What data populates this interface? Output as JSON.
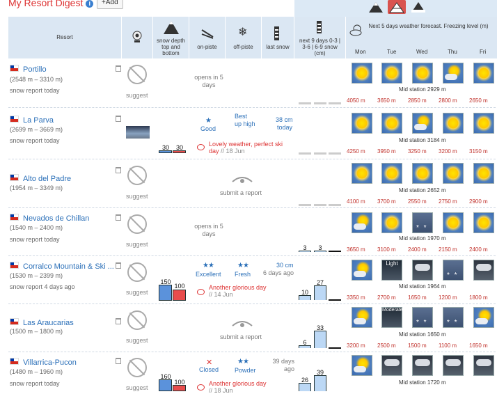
{
  "header": {
    "title": "My Resort Digest",
    "info_icon": "i",
    "add_label": "+Add"
  },
  "columns": {
    "resort": "Resort",
    "snow_depth": "snow depth top and bottom",
    "on_piste": "on-piste",
    "off_piste": "off-piste",
    "last_snow": "last snow",
    "next9": "next 9 days 0-3 | 3-6 | 6-9 snow (cm)",
    "forecast_title": "Next 5 days weather forecast. Freezing level (m)",
    "days": [
      "Mon",
      "Tue",
      "Wed",
      "Thu",
      "Fri"
    ]
  },
  "labels": {
    "suggest": "suggest",
    "submit_report": "submit a report",
    "mid_station": "Mid station"
  },
  "resorts": [
    {
      "name": "Portillo",
      "elev": "(2548 m – 3310 m)",
      "report": "snow report today",
      "opens": "opens in 5 days",
      "next9": [],
      "weather": [
        "sun",
        "sun",
        "sun",
        "pc",
        "sun"
      ],
      "mid": "2929 m",
      "freeze": [
        "4050 m",
        "3650 m",
        "2850 m",
        "2800 m",
        "2650 m"
      ]
    },
    {
      "name": "La Parva",
      "elev": "(2699 m – 3669 m)",
      "report": "snow report today",
      "depth": [
        "30",
        "30"
      ],
      "on_piste": "Good",
      "off_piste": "Best up high",
      "last_snow": "38 cm",
      "last_snow_when": "today",
      "comment": "Lovely weather, perfect ski day",
      "comment_date": "// 18 Jun",
      "weather": [
        "sun",
        "sun",
        "pc",
        "sun",
        "sun"
      ],
      "mid": "3184 m",
      "freeze": [
        "4250 m",
        "3950 m",
        "3250 m",
        "3200 m",
        "3150 m"
      ]
    },
    {
      "name": "Alto del Padre",
      "elev": "(1954 m – 3349 m)",
      "report": "",
      "weather": [
        "sun",
        "sun",
        "sun",
        "sun",
        "sun"
      ],
      "mid": "2652 m",
      "freeze": [
        "4100 m",
        "3700 m",
        "2550 m",
        "2750 m",
        "2900 m"
      ]
    },
    {
      "name": "Nevados de Chillan",
      "elev": "(1540 m – 2400 m)",
      "report": "snow report today",
      "opens": "opens in 5 days",
      "next9": [
        "3",
        "3",
        ""
      ],
      "weather": [
        "pc",
        "sun",
        "snow",
        "sun",
        "sun"
      ],
      "mid": "1970 m",
      "freeze": [
        "3650 m",
        "3100 m",
        "2400 m",
        "2150 m",
        "2400 m"
      ]
    },
    {
      "name": "Corralco Mountain & Ski ...",
      "elev": "(1530 m – 2399 m)",
      "report": "snow report 4 days ago",
      "depth": [
        "150",
        "100"
      ],
      "on_piste": "Excellent",
      "off_piste": "Fresh",
      "last_snow": "30 cm",
      "last_snow_when": "6 days ago",
      "comment": "Another glorious day",
      "comment_date": "// 14 Jun",
      "next9": [
        "10",
        "27",
        ""
      ],
      "weather": [
        "pc",
        "light",
        "heavy",
        "snow",
        "heavy"
      ],
      "weather_light_label": "Light",
      "mid": "1964 m",
      "freeze": [
        "3350 m",
        "2700 m",
        "1650 m",
        "1200 m",
        "1800 m"
      ]
    },
    {
      "name": "Las Araucarias",
      "elev": "(1500 m – 1800 m)",
      "report": "",
      "next9": [
        "6",
        "33",
        ""
      ],
      "weather": [
        "pc",
        "moderate",
        "snow",
        "snow",
        "pc"
      ],
      "weather_moderate_label": "Moderate",
      "mid": "1650 m",
      "freeze": [
        "3200 m",
        "2500 m",
        "1500 m",
        "1100 m",
        "1650 m"
      ]
    },
    {
      "name": "Villarrica-Pucon",
      "elev": "(1480 m – 1960 m)",
      "report": "snow report today",
      "depth": [
        "160",
        "100"
      ],
      "on_piste": "Closed",
      "off_piste": "Powder",
      "last_snow": "39 days ago",
      "comment": "Another glorious day",
      "comment_date": "// 18 Jun",
      "next9": [
        "26",
        "39",
        ""
      ],
      "weather": [
        "pc",
        "heavy",
        "heavy",
        "heavy",
        "heavy"
      ],
      "mid": "1720 m",
      "freeze": []
    }
  ]
}
